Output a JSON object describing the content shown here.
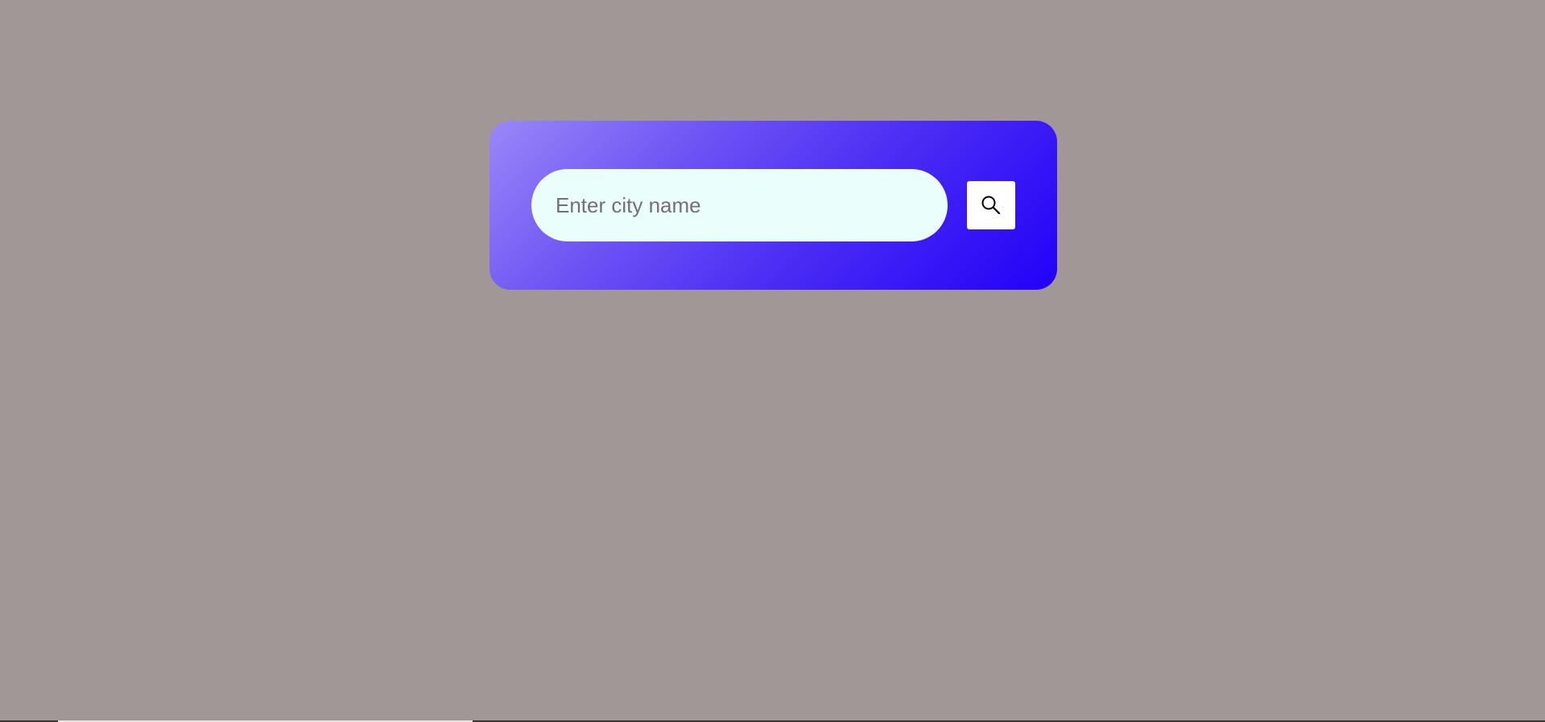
{
  "search": {
    "placeholder": "Enter city name",
    "value": "",
    "button_icon": "search-icon"
  },
  "colors": {
    "page_background": "#a29797",
    "card_gradient_start": "#9a88f8",
    "card_gradient_end": "#2200f8",
    "input_background": "#eafffb",
    "button_background": "#ffffff"
  }
}
